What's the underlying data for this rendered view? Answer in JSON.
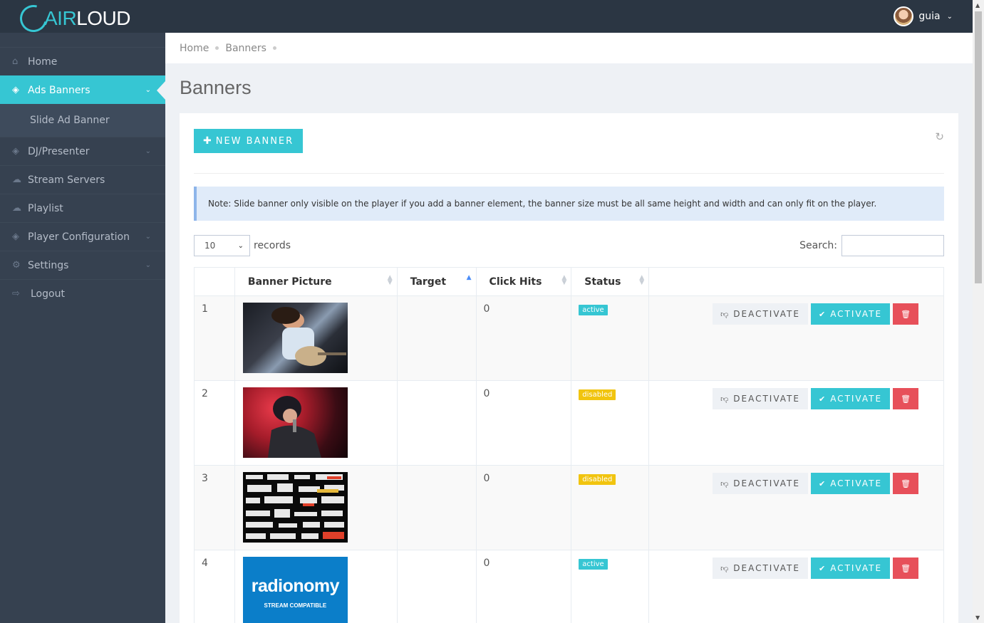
{
  "brand": {
    "air": "AIR",
    "loud": "LOUD"
  },
  "user": {
    "name": "guia"
  },
  "sidebar": {
    "items": [
      {
        "label": "Home",
        "icon": "home-icon",
        "glyph": "⌂"
      },
      {
        "label": "Ads Banners",
        "icon": "layers-icon",
        "glyph": "◈"
      },
      {
        "label": "DJ/Presenter",
        "icon": "layers-icon",
        "glyph": "◈"
      },
      {
        "label": "Stream Servers",
        "icon": "cloud-icon",
        "glyph": "☁"
      },
      {
        "label": "Playlist",
        "icon": "cloud-icon",
        "glyph": "☁"
      },
      {
        "label": "Player Configuration",
        "icon": "layers-icon",
        "glyph": "◈"
      },
      {
        "label": "Settings",
        "icon": "gears-icon",
        "glyph": "⚙"
      },
      {
        "label": "Logout",
        "icon": "logout-icon",
        "glyph": "⇨"
      }
    ],
    "sub_item": "Slide Ad Banner"
  },
  "breadcrumb": {
    "home": "Home",
    "current": "Banners"
  },
  "page": {
    "title": "Banners"
  },
  "toolbar": {
    "new_banner": "NEW BANNER"
  },
  "note": "Note: Slide banner only visible on the player if you add a banner element, the banner size must be all same height and width and can only fit on the player.",
  "table_controls": {
    "length_value": "10",
    "records_label": "records",
    "search_label": "Search:"
  },
  "table": {
    "headers": [
      "",
      "Banner Picture",
      "Target",
      "Click Hits",
      "Status",
      ""
    ],
    "rows": [
      {
        "num": "1",
        "target": "",
        "hits": "0",
        "status": "active"
      },
      {
        "num": "2",
        "target": "",
        "hits": "0",
        "status": "disabled"
      },
      {
        "num": "3",
        "target": "",
        "hits": "0",
        "status": "disabled"
      },
      {
        "num": "4",
        "target": "",
        "hits": "0",
        "status": "active"
      }
    ],
    "actions": {
      "deactivate": "DEACTIVATE",
      "activate": "ACTIVATE"
    },
    "radionomy": {
      "brand": "radionomy",
      "tagline": "STREAM COMPATIBLE"
    }
  },
  "colors": {
    "accent": "#36c6d3",
    "sidebar": "#364150",
    "topbar": "#2b3643",
    "danger": "#e7505a",
    "warning": "#f1c40f"
  }
}
